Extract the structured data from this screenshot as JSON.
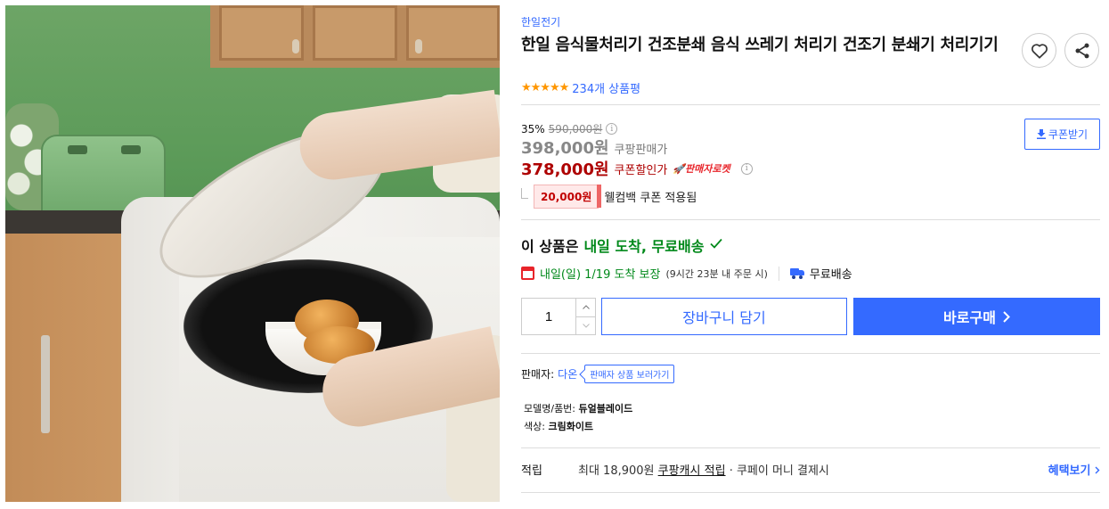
{
  "product": {
    "brand": "한일전기",
    "title": "한일 음식물처리기 건조분쇄 음식 쓰레기 처리기 건조기 분쇄기 처리기기",
    "review_count": "234개 상품평"
  },
  "pricing": {
    "discount_rate": "35%",
    "original_price": "590,000원",
    "sale_price": "398,000원",
    "sale_label": "쿠팡판매가",
    "coupon_price": "378,000원",
    "coupon_label": "쿠폰할인가",
    "rocket_badge": "판매자로켓",
    "coupon_button": "쿠폰받기",
    "welcome_amount": "20,000원",
    "welcome_text": "웰컴백 쿠폰 적용됨"
  },
  "delivery": {
    "headline_prefix": "이 상품은",
    "headline_highlight": "내일 도착, 무료배송",
    "eta_text": "내일(일) 1/19 도착 보장",
    "eta_detail": "(9시간 23분 내 주문 시)",
    "shipping": "무료배송"
  },
  "purchase": {
    "quantity": "1",
    "cart_button": "장바구니 담기",
    "buy_button": "바로구매"
  },
  "seller": {
    "label": "판매자:",
    "name": "다온",
    "view_products": "판매자 상품 보러가기"
  },
  "attributes": [
    {
      "key": "모델명/품번:",
      "value": "듀얼블레이드"
    },
    {
      "key": "색상:",
      "value": "크림화이트"
    }
  ],
  "reward": {
    "label": "적립",
    "detail_prefix": "최대 18,900원",
    "detail_link": "쿠팡캐시 적립",
    "detail_suffix": "· 쿠페이 머니 결제시",
    "benefits_link": "혜택보기"
  },
  "rating": {
    "stars": 5,
    "max": 5
  },
  "colors": {
    "accent": "#346aff",
    "coupon_red": "#ae0000",
    "delivery_green": "#00891a",
    "star": "#ff9600"
  },
  "icons": [
    "heart-icon",
    "share-icon",
    "info-icon",
    "download-icon",
    "rocket-icon",
    "check-icon",
    "calendar-icon",
    "truck-icon",
    "chevron-right-icon"
  ]
}
